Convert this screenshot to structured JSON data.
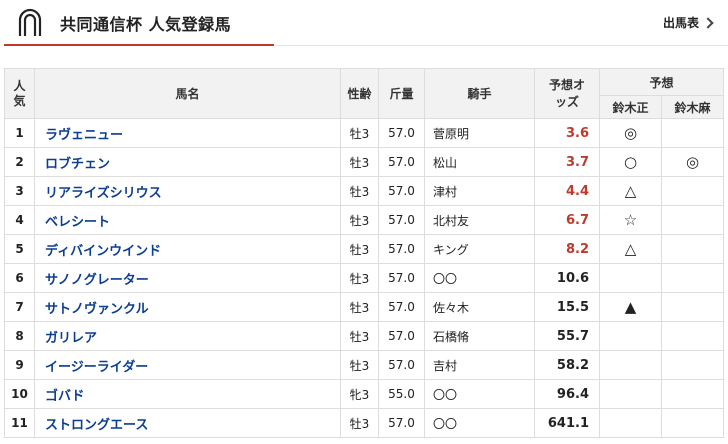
{
  "page": {
    "title": "共同通信杯 人気登録馬",
    "link_label": "出馬表"
  },
  "table": {
    "headers": {
      "rank": "人気",
      "name": "馬名",
      "sex_age": "性齢",
      "weight": "斤量",
      "jockey": "騎手",
      "odds": "予想オッズ",
      "predict_group": "予想",
      "predictor1": "鈴木正",
      "predictor2": "鈴木麻"
    },
    "rows": [
      {
        "rank": "1",
        "name": "ラヴェニュー",
        "sex_age": "牡3",
        "weight": "57.0",
        "jockey": "菅原明",
        "odds": "3.6",
        "odds_red": true,
        "mark1": "◎",
        "mark2": ""
      },
      {
        "rank": "2",
        "name": "ロブチェン",
        "sex_age": "牡3",
        "weight": "57.0",
        "jockey": "松山",
        "odds": "3.7",
        "odds_red": true,
        "mark1": "○",
        "mark2": "◎"
      },
      {
        "rank": "3",
        "name": "リアライズシリウス",
        "sex_age": "牡3",
        "weight": "57.0",
        "jockey": "津村",
        "odds": "4.4",
        "odds_red": true,
        "mark1": "△",
        "mark2": ""
      },
      {
        "rank": "4",
        "name": "ベレシート",
        "sex_age": "牡3",
        "weight": "57.0",
        "jockey": "北村友",
        "odds": "6.7",
        "odds_red": true,
        "mark1": "☆",
        "mark2": ""
      },
      {
        "rank": "5",
        "name": "ディバインウインド",
        "sex_age": "牡3",
        "weight": "57.0",
        "jockey": "キング",
        "odds": "8.2",
        "odds_red": true,
        "mark1": "△",
        "mark2": ""
      },
      {
        "rank": "6",
        "name": "サノノグレーター",
        "sex_age": "牡3",
        "weight": "57.0",
        "jockey": "〇〇",
        "odds": "10.6",
        "odds_red": false,
        "mark1": "",
        "mark2": ""
      },
      {
        "rank": "7",
        "name": "サトノヴァンクル",
        "sex_age": "牡3",
        "weight": "57.0",
        "jockey": "佐々木",
        "odds": "15.5",
        "odds_red": false,
        "mark1": "▲",
        "mark2": ""
      },
      {
        "rank": "8",
        "name": "ガリレア",
        "sex_age": "牡3",
        "weight": "57.0",
        "jockey": "石橋脩",
        "odds": "55.7",
        "odds_red": false,
        "mark1": "",
        "mark2": ""
      },
      {
        "rank": "9",
        "name": "イージーライダー",
        "sex_age": "牡3",
        "weight": "57.0",
        "jockey": "吉村",
        "odds": "58.2",
        "odds_red": false,
        "mark1": "",
        "mark2": ""
      },
      {
        "rank": "10",
        "name": "ゴバド",
        "sex_age": "牝3",
        "weight": "55.0",
        "jockey": "〇〇",
        "odds": "96.4",
        "odds_red": false,
        "mark1": "",
        "mark2": ""
      },
      {
        "rank": "11",
        "name": "ストロングエース",
        "sex_age": "牡3",
        "weight": "57.0",
        "jockey": "〇〇",
        "odds": "641.1",
        "odds_red": false,
        "mark1": "",
        "mark2": ""
      }
    ]
  },
  "colors": {
    "accent": "#c0392b",
    "horse_name": "#0b3d91"
  },
  "icons": {
    "logo": "horseshoe-icon",
    "link": "chevron-right-icon"
  }
}
